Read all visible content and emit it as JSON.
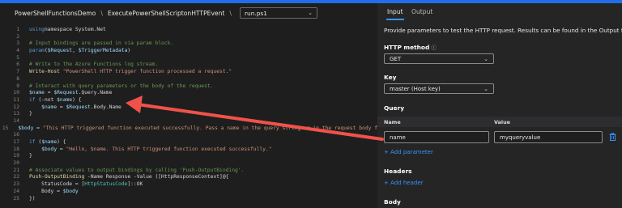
{
  "breadcrumb": {
    "items": [
      "PowerShellFunctionsDemo",
      "ExecutePowerShellScriptonHTTPEvent"
    ],
    "separator": "\\",
    "file": "run.ps1"
  },
  "code": {
    "lines": [
      {
        "n": "1",
        "t": [
          [
            "kw",
            "using"
          ],
          [
            "",
            "namespace System.Net"
          ]
        ]
      },
      {
        "n": "2",
        "t": []
      },
      {
        "n": "3",
        "t": [
          [
            "cm",
            "# Input bindings are passed in via param block."
          ]
        ]
      },
      {
        "n": "4",
        "t": [
          [
            "kw",
            "param"
          ],
          [
            "",
            "("
          ],
          [
            "vr",
            "$Request"
          ],
          [
            "",
            ", "
          ],
          [
            "vr",
            "$TriggerMetadata"
          ],
          [
            "",
            ")"
          ]
        ]
      },
      {
        "n": "5",
        "t": []
      },
      {
        "n": "6",
        "t": [
          [
            "cm",
            "# Write to the Azure Functions log stream."
          ]
        ]
      },
      {
        "n": "7",
        "t": [
          [
            "fn",
            "Write-Host"
          ],
          [
            "",
            ""
          ],
          [
            "st",
            " \"PowerShell HTTP trigger function processed a request.\""
          ]
        ]
      },
      {
        "n": "8",
        "t": []
      },
      {
        "n": "9",
        "t": [
          [
            "cm",
            "# Interact with query parameters or the body of the request."
          ]
        ]
      },
      {
        "n": "10",
        "t": [
          [
            "vr",
            "$name"
          ],
          [
            "",
            " = "
          ],
          [
            "vr",
            "$Request"
          ],
          [
            "",
            ".Query.Name"
          ]
        ]
      },
      {
        "n": "11",
        "t": [
          [
            "kw",
            "if"
          ],
          [
            "",
            " (-not "
          ],
          [
            "vr",
            "$name"
          ],
          [
            "",
            ") {"
          ]
        ]
      },
      {
        "n": "12",
        "t": [
          [
            "",
            "    "
          ],
          [
            "vr",
            "$name"
          ],
          [
            "",
            " = "
          ],
          [
            "vr",
            "$Request"
          ],
          [
            "",
            ".Body.Name"
          ]
        ]
      },
      {
        "n": "13",
        "t": [
          [
            "",
            "}"
          ]
        ]
      },
      {
        "n": "14",
        "t": []
      },
      {
        "n": "15",
        "t": [
          [
            "vr",
            "$body"
          ],
          [
            "",
            " = "
          ],
          [
            "st",
            "\"This HTTP triggered function executed successfully. Pass a name in the query string or in the request body f"
          ]
        ]
      },
      {
        "n": "16",
        "t": []
      },
      {
        "n": "17",
        "t": [
          [
            "kw",
            "if"
          ],
          [
            "",
            " ("
          ],
          [
            "vr",
            "$name"
          ],
          [
            "",
            ") {"
          ]
        ]
      },
      {
        "n": "18",
        "t": [
          [
            "",
            "    "
          ],
          [
            "vr",
            "$body"
          ],
          [
            "",
            " = "
          ],
          [
            "st",
            "\"Hello, $name. This HTTP triggered function executed successfully.\""
          ]
        ]
      },
      {
        "n": "19",
        "t": [
          [
            "",
            "}"
          ]
        ]
      },
      {
        "n": "20",
        "t": []
      },
      {
        "n": "21",
        "t": [
          [
            "cm",
            "# Associate values to output bindings by calling 'Push-OutputBinding'."
          ]
        ]
      },
      {
        "n": "22",
        "t": [
          [
            "fn",
            "Push-OutputBinding"
          ],
          [
            "",
            " -Name Response -Value ([HttpResponseContext]@{"
          ]
        ]
      },
      {
        "n": "23",
        "t": [
          [
            "",
            "    StatusCode = ["
          ],
          [
            "ty",
            "HttpStatusCode"
          ],
          [
            "",
            "]::OK"
          ]
        ]
      },
      {
        "n": "24",
        "t": [
          [
            "",
            "    Body = "
          ],
          [
            "vr",
            "$body"
          ]
        ]
      },
      {
        "n": "25",
        "t": [
          [
            "",
            "})"
          ]
        ]
      }
    ]
  },
  "panel": {
    "tabs": [
      "Input",
      "Output"
    ],
    "description": "Provide parameters to test the HTTP request. Results can be found in the Output tab.",
    "http_method_label": "HTTP method",
    "http_method_value": "GET",
    "key_label": "Key",
    "key_value": "master (Host key)",
    "query_label": "Query",
    "col_name": "Name",
    "col_value": "Value",
    "query_param_name": "name",
    "query_param_value": "myqueryvalue",
    "add_parameter": "+ Add parameter",
    "headers_label": "Headers",
    "add_header": "+ Add header",
    "body_label": "Body"
  },
  "colors": {
    "accent": "#3794ff",
    "arrow": "#f0524a"
  },
  "icons": [
    "info-icon",
    "chevron-down-icon",
    "trash-icon"
  ]
}
